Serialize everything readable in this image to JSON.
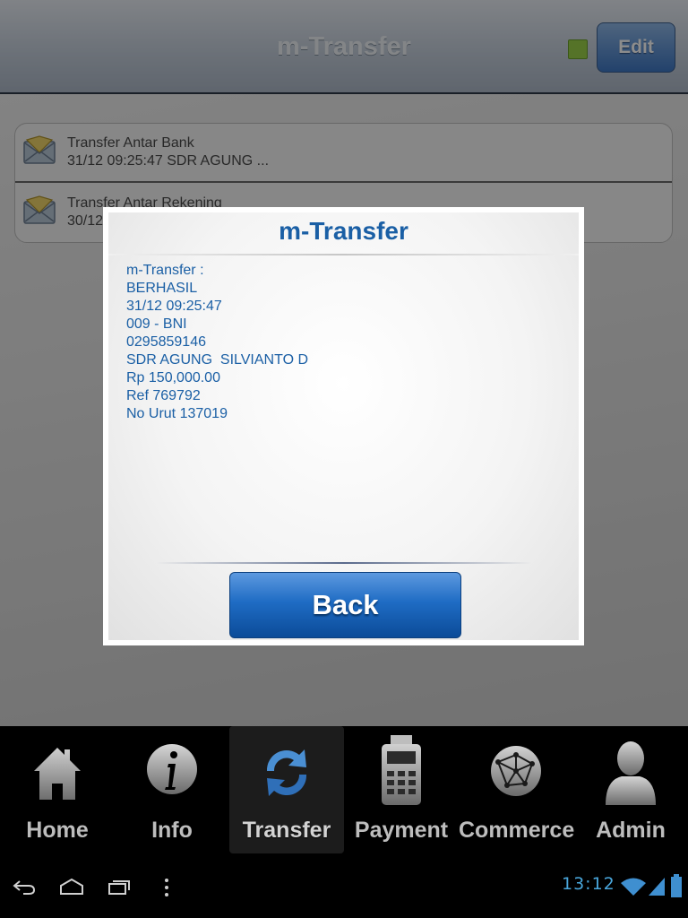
{
  "header": {
    "title": "m-Transfer",
    "edit_label": "Edit"
  },
  "messages": [
    {
      "title": "Transfer Antar Bank",
      "subtitle": "31/12 09:25:47 SDR AGUNG  ..."
    },
    {
      "title": "Transfer Antar Rekening",
      "subtitle": "30/12"
    }
  ],
  "dialog": {
    "title": "m-Transfer",
    "lines": [
      "m-Transfer :",
      "BERHASIL",
      "31/12 09:25:47",
      "009 - BNI",
      "0295859146",
      "SDR AGUNG  SILVIANTO D",
      "Rp 150,000.00",
      "Ref 769792",
      "No Urut 137019"
    ],
    "back_label": "Back"
  },
  "tabs": [
    {
      "label": "Home",
      "icon": "home-icon"
    },
    {
      "label": "Info",
      "icon": "info-icon"
    },
    {
      "label": "Transfer",
      "icon": "transfer-icon",
      "active": true
    },
    {
      "label": "Payment",
      "icon": "payment-icon"
    },
    {
      "label": "Commerce",
      "icon": "commerce-icon"
    },
    {
      "label": "Admin",
      "icon": "admin-icon"
    }
  ],
  "system_bar": {
    "time": "13:12",
    "icons": [
      "back-icon",
      "home-nav-icon",
      "recent-apps-icon",
      "menu-icon",
      "wifi-icon",
      "signal-icon",
      "battery-icon"
    ]
  },
  "colors": {
    "accent": "#1a5fa5",
    "button_blue": "#1f6cc4",
    "status_green": "#9bd14a",
    "clock_blue": "#49a6db"
  }
}
